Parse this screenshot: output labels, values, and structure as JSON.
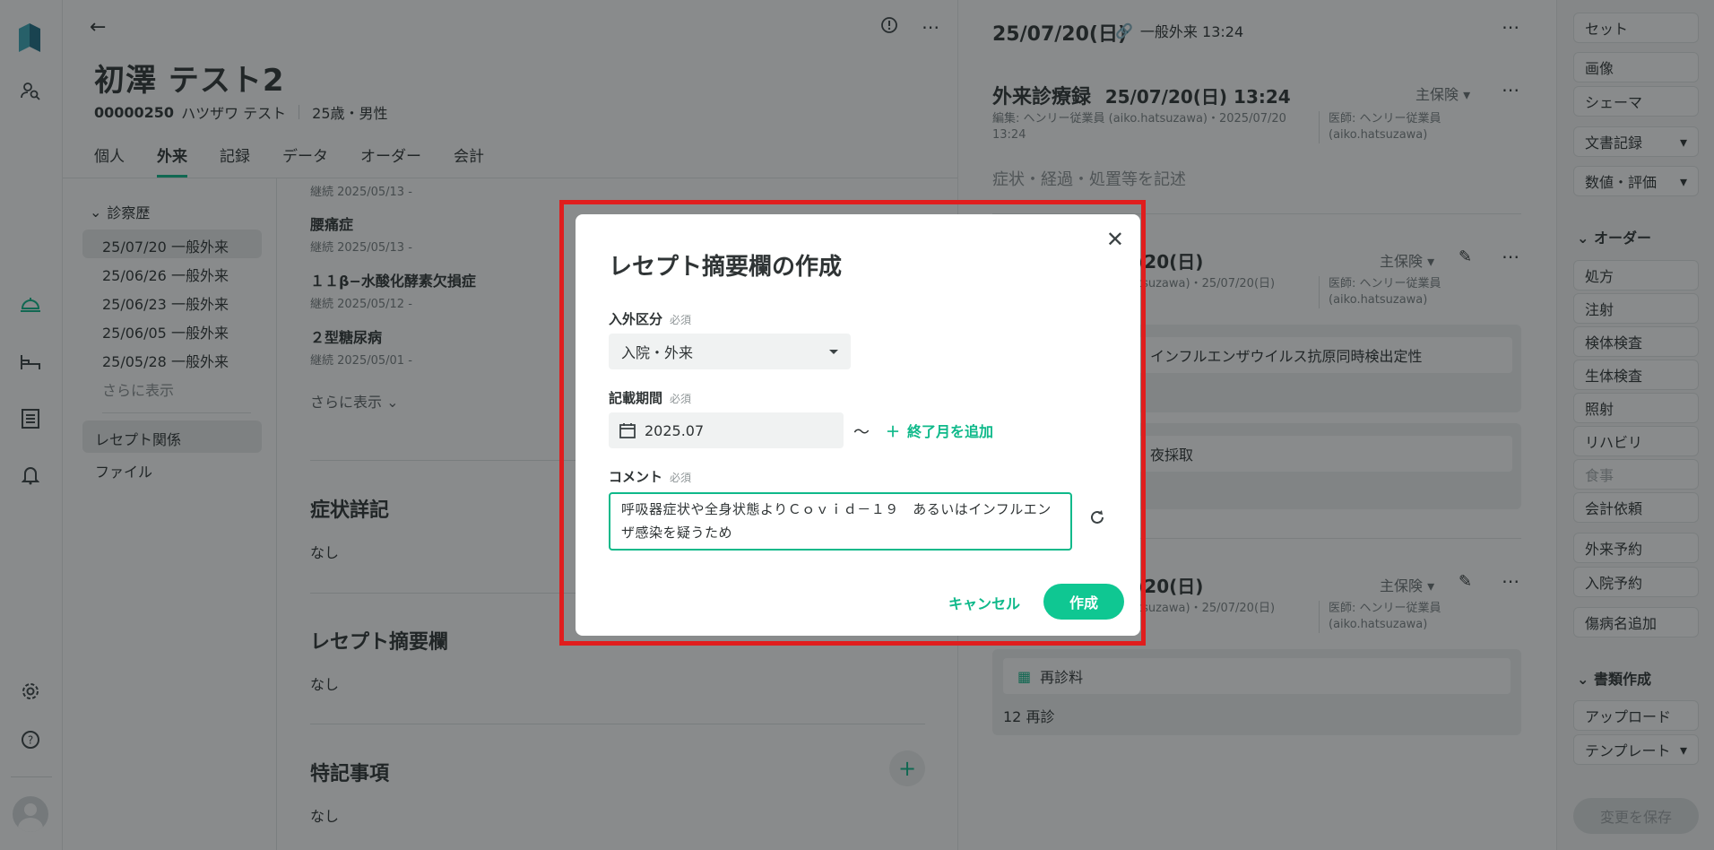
{
  "patient": {
    "name": "初澤 テスト2",
    "id": "00000250",
    "kana": "ハツザワ テスト",
    "age_sex": "25歳・男性"
  },
  "tabs": [
    "個人",
    "外来",
    "記録",
    "データ",
    "オーダー",
    "会計"
  ],
  "active_tab": "外来",
  "subnav": {
    "history_label": "診察歴",
    "visits": [
      "25/07/20 一般外来",
      "25/06/26 一般外来",
      "25/06/23 一般外来",
      "25/06/05 一般外来",
      "25/05/28 一般外来"
    ],
    "show_more": "さらに表示",
    "sections": [
      "レセプト関係",
      "ファイル"
    ]
  },
  "diagnoses": [
    {
      "title": "",
      "sub": "継続 2025/05/13 -"
    },
    {
      "title": "腰痛症",
      "sub": "継続 2025/05/13 -"
    },
    {
      "title": "１１β−水酸化酵素欠損症",
      "sub": "継続 2025/05/12 -"
    },
    {
      "title": "２型糖尿病",
      "sub": "継続 2025/05/01 -"
    }
  ],
  "diagnoses_more": "さらに表示",
  "sections": [
    {
      "title": "症状詳記",
      "value": "なし"
    },
    {
      "title": "レセプト摘要欄",
      "value": "なし"
    },
    {
      "title": "特記事項",
      "value": "なし"
    }
  ],
  "chart": {
    "date": "25/07/20(日)",
    "visit_link": "一般外来 13:24",
    "record_title": "外来診療録",
    "record_datetime": "25/07/20(日) 13:24",
    "insurance": "主保険",
    "edit_meta": "編集: ヘンリー従業員 (aiko.hatsuzawa)・2025/07/20 13:24",
    "doctor_meta": "医師: ヘンリー従業員 (aiko.hatsuzawa)",
    "placeholder": "症状・経過・処置等を記述",
    "card1_date": "/20(日)",
    "card1_meta": "tsuzawa)・25/07/20(日)",
    "card1_row1": "インフルエンザウイルス抗原同時検出定性",
    "card1_row2": "夜採取",
    "card2_date": "/20(日)",
    "card2_meta": "tsuzawa)・25/07/20(日)",
    "card2_row": "再診料",
    "card2_sub": "12 再診"
  },
  "actions": {
    "top": [
      "セット",
      "画像",
      "シェーマ",
      "文書記録",
      "数値・評価"
    ],
    "order_group": "オーダー",
    "orders": [
      "処方",
      "注射",
      "検体検査",
      "生体検査",
      "照射",
      "リハビリ",
      "食事",
      "会計依頼"
    ],
    "reserve": [
      "外来予約",
      "入院予約"
    ],
    "disease_add": "傷病名追加",
    "doc_group": "書類作成",
    "docs": [
      "アップロード",
      "テンプレート"
    ],
    "save": "変更を保存"
  },
  "modal": {
    "title": "レセプト摘要欄の作成",
    "required": "必須",
    "field1_label": "入外区分",
    "field1_value": "入院・外来",
    "field2_label": "記載期間",
    "field2_value": "2025.07",
    "tilde": "〜",
    "add_end_month": "終了月を追加",
    "field3_label": "コメント",
    "comment": "呼吸器症状や全身状態よりＣｏｖｉｄ－１９　あるいはインフルエンザ感染を疑うため",
    "cancel": "キャンセル",
    "create": "作成"
  },
  "colors": {
    "accent": "#0fc792",
    "highlight": "#e01d1d"
  }
}
